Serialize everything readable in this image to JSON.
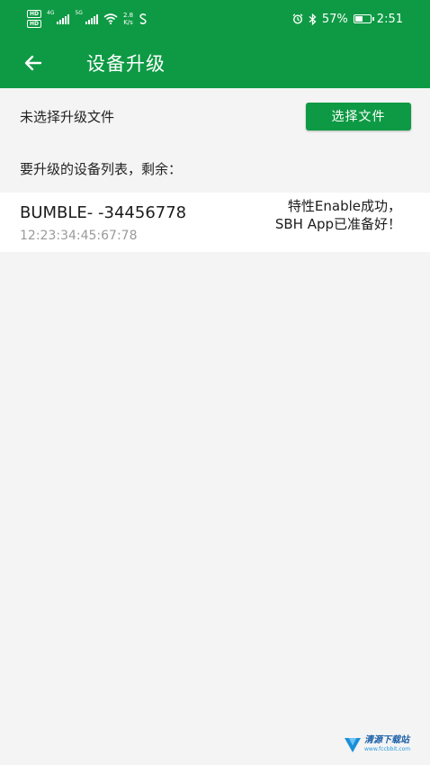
{
  "status_bar": {
    "hd1": "HD",
    "hd2": "HD",
    "sim1_net": "4G",
    "sim2_net": "5G",
    "speed_value": "2.8",
    "speed_unit": "K/s",
    "battery_percent": "57%",
    "battery_level": 0.57,
    "time": "2:51",
    "icons": [
      "hd-icon",
      "signal-icon",
      "wifi-icon",
      "data-saver-icon",
      "alarm-icon",
      "bluetooth-icon",
      "battery-icon"
    ]
  },
  "appbar": {
    "title": "设备升级",
    "back_icon": "arrow-left-icon"
  },
  "file": {
    "status": "未选择升级文件",
    "select_button": "选择文件"
  },
  "device_list": {
    "header": "要升级的设备列表，剩余：",
    "items": [
      {
        "name": "BUMBLE- -34456778",
        "mac": "12:23:34:45:67:78",
        "status": "特性Enable成功，SBH App已准备好！"
      }
    ]
  },
  "watermark": {
    "brand": "清源下载站",
    "url": "www.fccbbit.com"
  },
  "colors": {
    "primary": "#0e9a44",
    "background": "#f4f4f4",
    "row_background": "#ffffff",
    "secondary_text": "#9a9a9a"
  }
}
